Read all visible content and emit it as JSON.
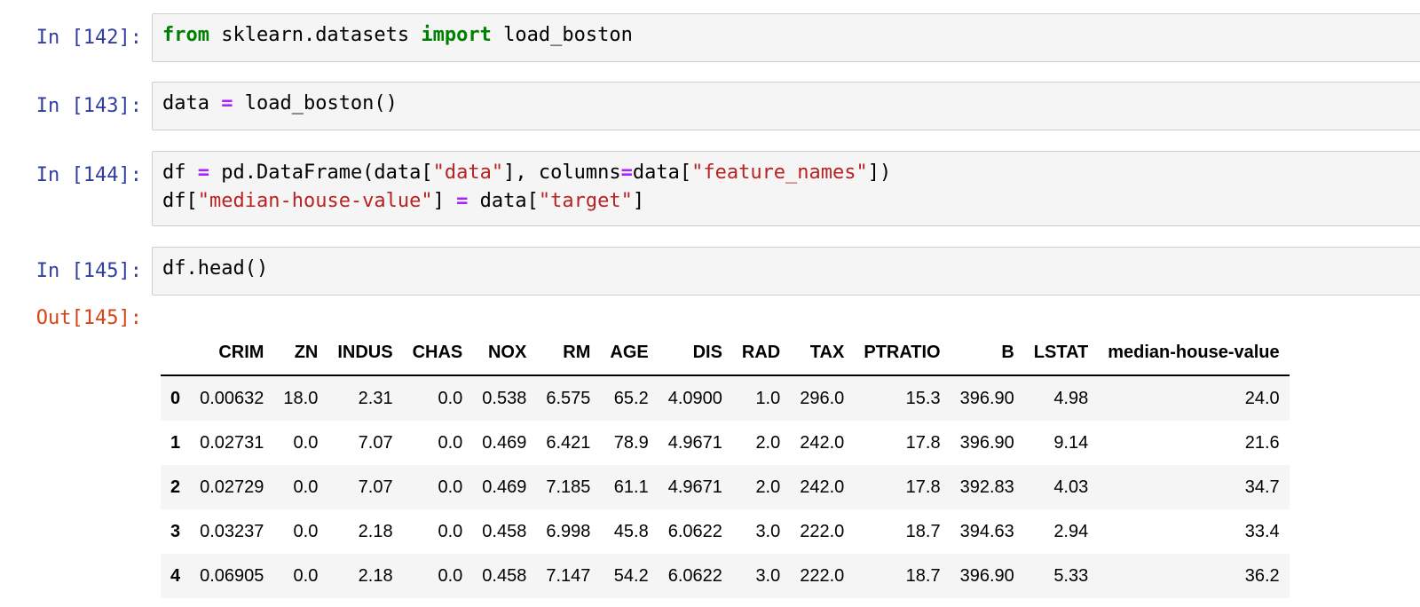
{
  "cells": [
    {
      "prompt": "In [142]:",
      "code": [
        {
          "kw": "from"
        },
        {
          "t": " sklearn.datasets "
        },
        {
          "kw": "import"
        },
        {
          "t": " load_boston"
        }
      ]
    },
    {
      "prompt": "In [143]:",
      "code": [
        {
          "t": "data "
        },
        {
          "op": "="
        },
        {
          "t": " load_boston()"
        }
      ]
    },
    {
      "prompt": "In [144]:",
      "line1": [
        {
          "t": "df "
        },
        {
          "op": "="
        },
        {
          "t": " pd.DataFrame(data["
        },
        {
          "str": "\"data\""
        },
        {
          "t": "], columns"
        },
        {
          "op": "="
        },
        {
          "t": "data["
        },
        {
          "str": "\"feature_names\""
        },
        {
          "t": "])"
        }
      ],
      "line2": [
        {
          "t": "df["
        },
        {
          "str": "\"median-house-value\""
        },
        {
          "t": "] "
        },
        {
          "op": "="
        },
        {
          "t": " data["
        },
        {
          "str": "\"target\""
        },
        {
          "t": "]"
        }
      ]
    },
    {
      "prompt": "In [145]:",
      "code": [
        {
          "t": "df.head()"
        }
      ]
    }
  ],
  "output": {
    "prompt": "Out[145]:",
    "columns": [
      "",
      "CRIM",
      "ZN",
      "INDUS",
      "CHAS",
      "NOX",
      "RM",
      "AGE",
      "DIS",
      "RAD",
      "TAX",
      "PTRATIO",
      "B",
      "LSTAT",
      "median-house-value"
    ],
    "rows": [
      [
        "0",
        "0.00632",
        "18.0",
        "2.31",
        "0.0",
        "0.538",
        "6.575",
        "65.2",
        "4.0900",
        "1.0",
        "296.0",
        "15.3",
        "396.90",
        "4.98",
        "24.0"
      ],
      [
        "1",
        "0.02731",
        "0.0",
        "7.07",
        "0.0",
        "0.469",
        "6.421",
        "78.9",
        "4.9671",
        "2.0",
        "242.0",
        "17.8",
        "396.90",
        "9.14",
        "21.6"
      ],
      [
        "2",
        "0.02729",
        "0.0",
        "7.07",
        "0.0",
        "0.469",
        "7.185",
        "61.1",
        "4.9671",
        "2.0",
        "242.0",
        "17.8",
        "392.83",
        "4.03",
        "34.7"
      ],
      [
        "3",
        "0.03237",
        "0.0",
        "2.18",
        "0.0",
        "0.458",
        "6.998",
        "45.8",
        "6.0622",
        "3.0",
        "222.0",
        "18.7",
        "394.63",
        "2.94",
        "33.4"
      ],
      [
        "4",
        "0.06905",
        "0.0",
        "2.18",
        "0.0",
        "0.458",
        "7.147",
        "54.2",
        "6.0622",
        "3.0",
        "222.0",
        "18.7",
        "396.90",
        "5.33",
        "36.2"
      ]
    ]
  }
}
